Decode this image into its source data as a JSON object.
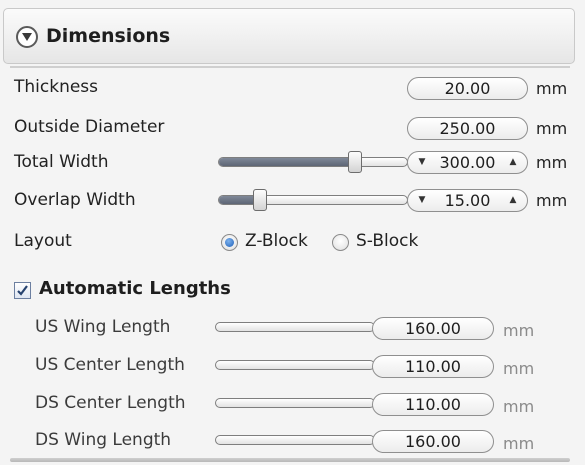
{
  "section": {
    "title": "Dimensions"
  },
  "fields": [
    {
      "label": "Thickness",
      "value": "20.00",
      "unit": "mm"
    },
    {
      "label": "Outside Diameter",
      "value": "250.00",
      "unit": "mm"
    },
    {
      "label": "Total Width",
      "value": "300.00",
      "unit": "mm",
      "slider_level": 0.72
    },
    {
      "label": "Overlap Width",
      "value": "15.00",
      "unit": "mm",
      "slider_level": 0.22
    }
  ],
  "layout": {
    "label": "Layout",
    "options": [
      "Z-Block",
      "S-Block"
    ],
    "selected": "Z-Block"
  },
  "auto_lengths": {
    "label": "Automatic Lengths",
    "checked": true,
    "items": [
      {
        "label": "US Wing Length",
        "value": "160.00",
        "unit": "mm"
      },
      {
        "label": "US Center Length",
        "value": "110.00",
        "unit": "mm"
      },
      {
        "label": "DS Center Length",
        "value": "110.00",
        "unit": "mm"
      },
      {
        "label": "DS Wing Length",
        "value": "160.00",
        "unit": "mm"
      }
    ]
  },
  "colors": {
    "accent": "#1f5fb8",
    "slider_fill": "#6b7383",
    "disabled_text": "#8a8a8a"
  }
}
